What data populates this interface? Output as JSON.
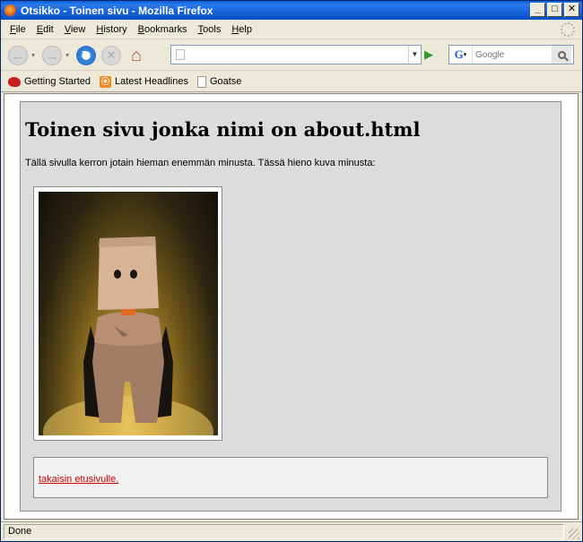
{
  "window": {
    "title": "Otsikko - Toinen sivu - Mozilla Firefox",
    "minimize": "_",
    "maximize": "□",
    "close": "✕"
  },
  "menu": [
    {
      "label": "File",
      "underline": "F",
      "rest": "ile"
    },
    {
      "label": "Edit",
      "underline": "E",
      "rest": "dit"
    },
    {
      "label": "View",
      "underline": "V",
      "rest": "iew"
    },
    {
      "label": "History",
      "underline": "H",
      "rest": "istory"
    },
    {
      "label": "Bookmarks",
      "underline": "B",
      "rest": "ookmarks"
    },
    {
      "label": "Tools",
      "underline": "T",
      "rest": "ools"
    },
    {
      "label": "Help",
      "underline": "H",
      "rest": "elp"
    }
  ],
  "toolbar": {
    "url_value": "",
    "search_placeholder": "Google",
    "icons": [
      "back-arrow-icon",
      "forward-arrow-icon",
      "reload-icon",
      "stop-icon",
      "home-icon",
      "go-arrow-icon",
      "google-icon",
      "magnifier-icon"
    ]
  },
  "bookmarks": [
    {
      "label": "Getting Started",
      "icon": "firefox-red-icon"
    },
    {
      "label": "Latest Headlines",
      "icon": "rss-icon"
    },
    {
      "label": "Goatse",
      "icon": "page-icon"
    }
  ],
  "page": {
    "heading": "Toinen sivu jonka nimi on about.html",
    "intro": "Tällä sivulla kerron jotain hieman enemmän minusta. Tässä hieno kuva minusta:",
    "back_link": "takaisin etusivulle."
  },
  "status": {
    "text": "Done"
  },
  "colors": {
    "titlebar": "#0a5fd8",
    "page_box_bg": "#dcdcdc",
    "link_color": "#cc0000"
  }
}
